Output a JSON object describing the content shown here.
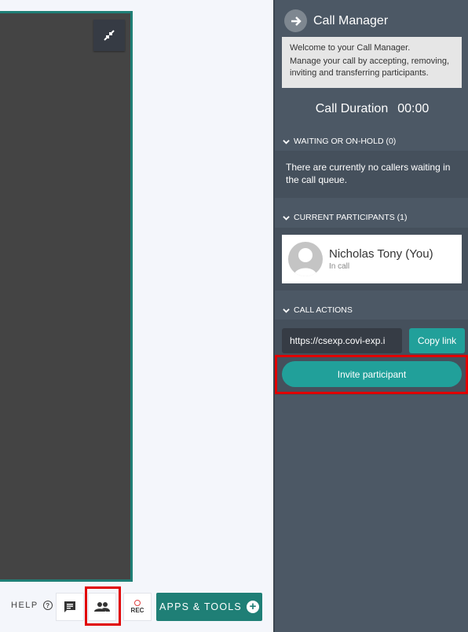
{
  "video": {
    "minimize_icon": "minimize-arrows-icon"
  },
  "toolbar": {
    "help_label": "HELP",
    "help_icon": "question-circle-icon",
    "chat_icon": "chat-icon",
    "participants_icon": "people-icon",
    "rec_label": "REC",
    "apps_label": "APPS & TOOLS",
    "apps_icon": "plus-circle-icon"
  },
  "panel": {
    "title": "Call Manager",
    "title_icon": "arrow-right-circle-icon",
    "welcome_line1": "Welcome to your Call Manager.",
    "welcome_line2": "Manage your call by accepting, removing, inviting and transferring participants.",
    "duration_label": "Call Duration",
    "duration_value": "00:00",
    "sections": {
      "waiting": {
        "label": "WAITING OR ON-HOLD (0)",
        "empty_text": "There are currently no callers waiting in the call queue."
      },
      "participants": {
        "label": "CURRENT PARTICIPANTS (1)",
        "items": [
          {
            "name": "Nicholas Tony (You)",
            "status": "In call"
          }
        ]
      },
      "actions": {
        "label": "CALL ACTIONS",
        "link_value": "https://csexp.covi-exp.i",
        "copy_label": "Copy link",
        "invite_label": "Invite participant"
      }
    }
  },
  "colors": {
    "accent": "#21a09a",
    "apps_button": "#1f7f76",
    "panel_bg": "#4c5865",
    "highlight": "#e10000"
  }
}
